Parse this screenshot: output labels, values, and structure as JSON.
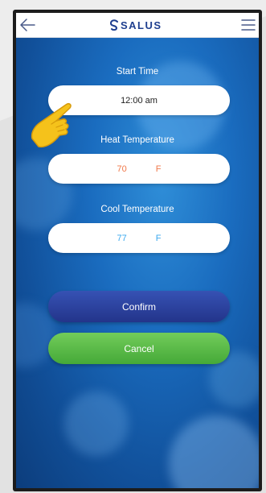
{
  "header": {
    "logo_text": "SALUS",
    "back_icon": "arrow-left-icon",
    "menu_icon": "hamburger-menu-icon"
  },
  "form": {
    "start_time": {
      "label": "Start Time",
      "value": "12:00 am"
    },
    "heat_temperature": {
      "label": "Heat Temperature",
      "value": "70",
      "unit": "F",
      "color": "#f0784a"
    },
    "cool_temperature": {
      "label": "Cool Temperature",
      "value": "77",
      "unit": "F",
      "color": "#3aa8ee"
    }
  },
  "actions": {
    "confirm_label": "Confirm",
    "cancel_label": "Cancel"
  },
  "colors": {
    "brand": "#1f3f8f",
    "confirm": "#2b3f9c",
    "cancel": "#5bbd47"
  },
  "pointer": "tap-hand-icon"
}
